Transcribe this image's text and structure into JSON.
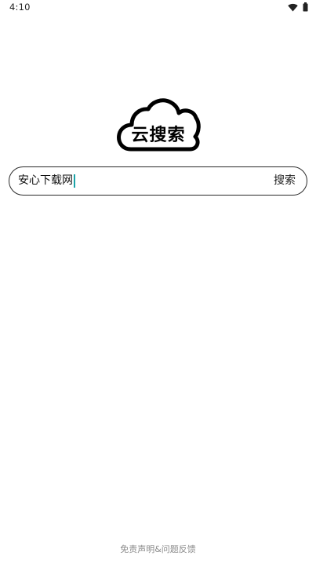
{
  "status_bar": {
    "time": "4:10",
    "icons": [
      "wifi-icon",
      "battery-icon"
    ]
  },
  "logo": {
    "text": "云搜索",
    "icon": "cloud-icon"
  },
  "search": {
    "value": "安心下载网",
    "button_label": "搜索"
  },
  "footer": {
    "link_text": "免责声明&问题反馈"
  },
  "colors": {
    "background": "#ffffff",
    "caret": "#1ba3a8",
    "border": "#2a2a2a",
    "footer_text": "#8a8a8a"
  }
}
